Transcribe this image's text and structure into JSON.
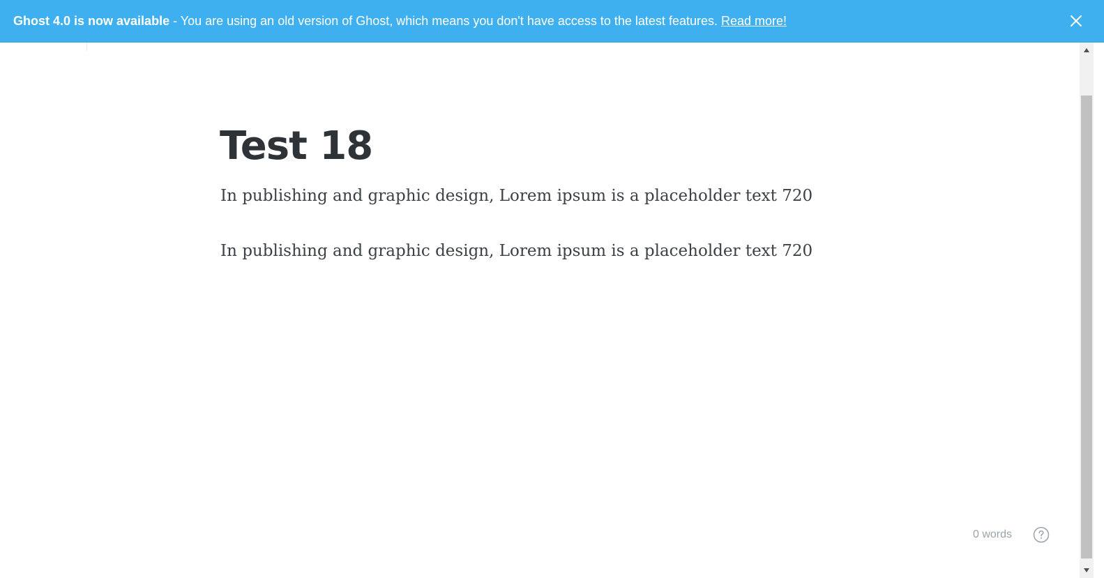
{
  "banner": {
    "headline": "Ghost 4.0 is now available",
    "message": " - You are using an old version of Ghost, which means you don't have access to the latest features.",
    "link_text": "Read more!",
    "background_color": "#3eb0ef",
    "close_icon": "close-icon"
  },
  "editor": {
    "title": "Test 18",
    "paragraphs": [
      "In publishing and graphic design, Lorem ipsum is a placeholder text 720",
      "In publishing and graphic design, Lorem ipsum is a placeholder text 720"
    ]
  },
  "footer": {
    "word_count": "0 words",
    "help_icon": "question-mark-icon"
  }
}
